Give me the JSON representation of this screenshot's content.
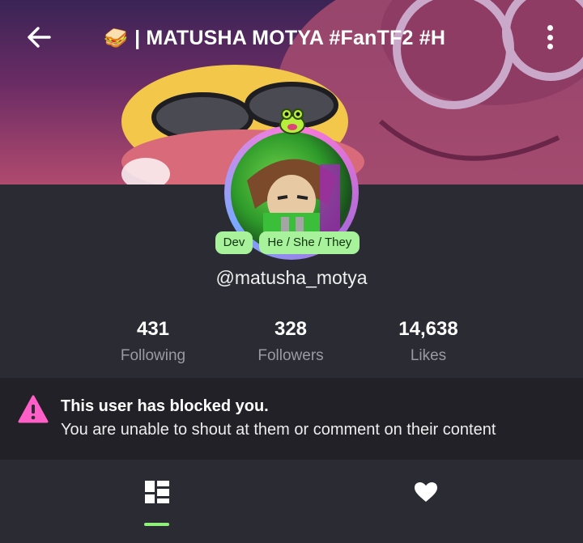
{
  "header": {
    "title_emoji": "🥪",
    "title": "| MATUSHA MOTYA #FanTF2 #H",
    "back_icon": "arrow-left-icon",
    "more_icon": "more-vertical-icon"
  },
  "profile": {
    "badges": [
      "Dev",
      "He / She / They"
    ],
    "username": "@matusha_motya"
  },
  "stats": [
    {
      "value": "431",
      "label": "Following"
    },
    {
      "value": "328",
      "label": "Followers"
    },
    {
      "value": "14,638",
      "label": "Likes"
    }
  ],
  "notice": {
    "icon": "warning-icon",
    "title": "This user has blocked you.",
    "text": "You are unable to shout at them or comment on their content"
  },
  "tabs": [
    {
      "icon": "dashboard-icon",
      "selected": true
    },
    {
      "icon": "heart-icon",
      "selected": false
    }
  ],
  "colors": {
    "accent": "#a7f29b",
    "warning": "#ff5fc7",
    "background": "#2b2b33",
    "notice_background": "#212127"
  }
}
